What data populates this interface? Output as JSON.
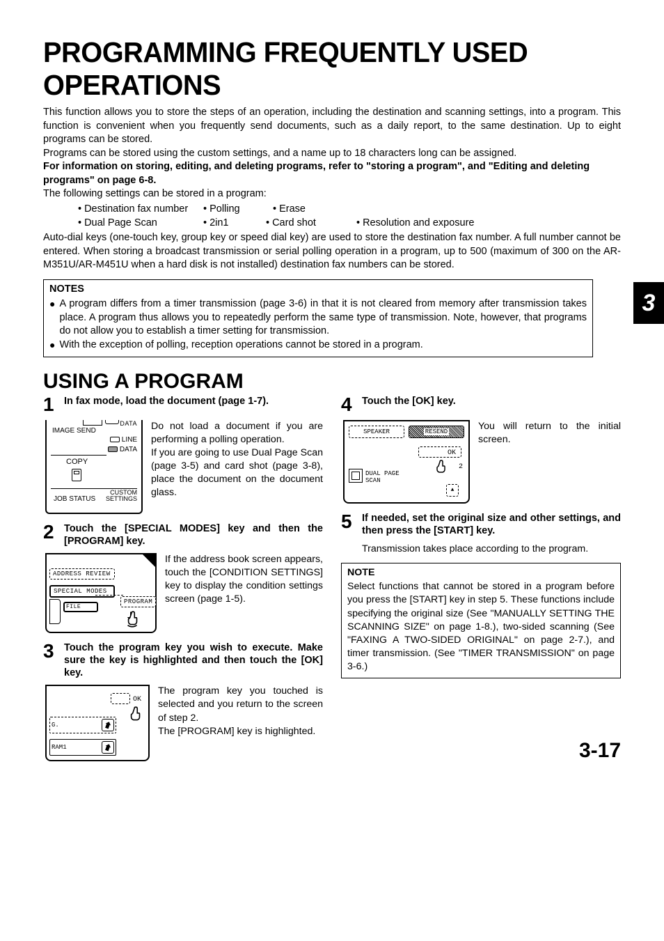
{
  "tab_number": "3",
  "main_title": "PROGRAMMING FREQUENTLY USED OPERATIONS",
  "intro": {
    "p1": "This function allows you to store the steps of an operation, including the destination and scanning settings, into a program. This function is convenient when you frequently send documents, such as a daily report, to the same destination. Up to eight programs can be stored.",
    "p2": "Programs can be stored using the custom settings, and a name up to 18 characters long can be assigned.",
    "p3_bold": "For information on storing, editing, and deleting programs, refer to \"storing a program\", and \"Editing and deleting programs\" on page 6-8.",
    "p4": "The following settings can be stored in a program:",
    "p5": "Auto-dial keys (one-touch key, group key or speed dial key) are used to store the destination fax number. A full number cannot be entered. When storing a broadcast transmission or serial polling operation in a program, up to 500 (maximum of 300 on the AR-M351U/AR-M451U when a hard disk is not installed) destination fax numbers can be stored."
  },
  "settings": {
    "r1": {
      "a": "Destination fax number",
      "b": "Polling",
      "c": "Erase"
    },
    "r2": {
      "a": "Dual Page Scan",
      "b": "2in1",
      "c": "Card shot",
      "d": "Resolution and exposure"
    }
  },
  "notes": {
    "heading": "NOTES",
    "n1": "A program differs from a timer transmission (page 3-6) in that it is not cleared from memory after transmission takes place. A program thus allows you to repeatedly perform the same type of transmission. Note, however, that programs do not allow you to establish a timer setting for transmission.",
    "n2": "With the exception of polling, reception operations cannot be stored in a program."
  },
  "section_title": "USING A PROGRAM",
  "steps": {
    "s1": {
      "num": "1",
      "title": "In fax mode, load the document (page 1-7).",
      "body": "Do not load a document if you are performing a polling operation.\nIf you are going to use Dual Page Scan (page 3-5) and card shot (page 3-8), place the document on the document glass.",
      "g": {
        "imgsend": "IMAGE SEND",
        "data": "DATA",
        "line": "LINE",
        "data2": "DATA",
        "copy": "COPY",
        "job": "JOB STATUS",
        "custom": "CUSTOM\nSETTINGS"
      }
    },
    "s2": {
      "num": "2",
      "title": "Touch the [SPECIAL MODES] key and then the [PROGRAM] key.",
      "body": "If the address book screen appears, touch the [CONDITION SETTINGS] key to display the condition settings screen (page 1-5).",
      "g": {
        "ar": "ADDRESS REVIEW",
        "sm": "SPECIAL MODES",
        "fl": "FILE",
        "pg": "PROGRAM"
      }
    },
    "s3": {
      "num": "3",
      "title": "Touch the program key you wish to execute. Make sure the key is highlighted and then touch the [OK] key.",
      "body": "The program key you touched is selected and you return to the screen of step 2.\nThe [PROGRAM] key is highlighted.",
      "g": {
        "ok": "OK",
        "r1": "G.",
        "r2": "RAM1"
      }
    },
    "s4": {
      "num": "4",
      "title": "Touch the [OK] key.",
      "body": "You will return to the initial screen.",
      "g": {
        "sp": "SPEAKER",
        "re": "RESEND",
        "ok": "OK",
        "dual": "DUAL PAGE\nSCAN",
        "two": "2"
      }
    },
    "s5": {
      "num": "5",
      "title": "If needed, set the original size and other settings, and then press the [START] key.",
      "sub": "Transmission takes place according to the program."
    }
  },
  "note_small": {
    "heading": "NOTE",
    "body": "Select functions that cannot be stored in a program before you press the [START] key in step 5. These functions include specifying the original size (See \"MANUALLY SETTING THE SCANNING SIZE\" on page 1-8.), two-sided scanning (See \"FAXING A TWO-SIDED ORIGINAL\" on page 2-7.), and timer transmission. (See \"TIMER TRANSMISSION\" on page 3-6.)"
  },
  "page_number": "3-17",
  "chart_data": null
}
